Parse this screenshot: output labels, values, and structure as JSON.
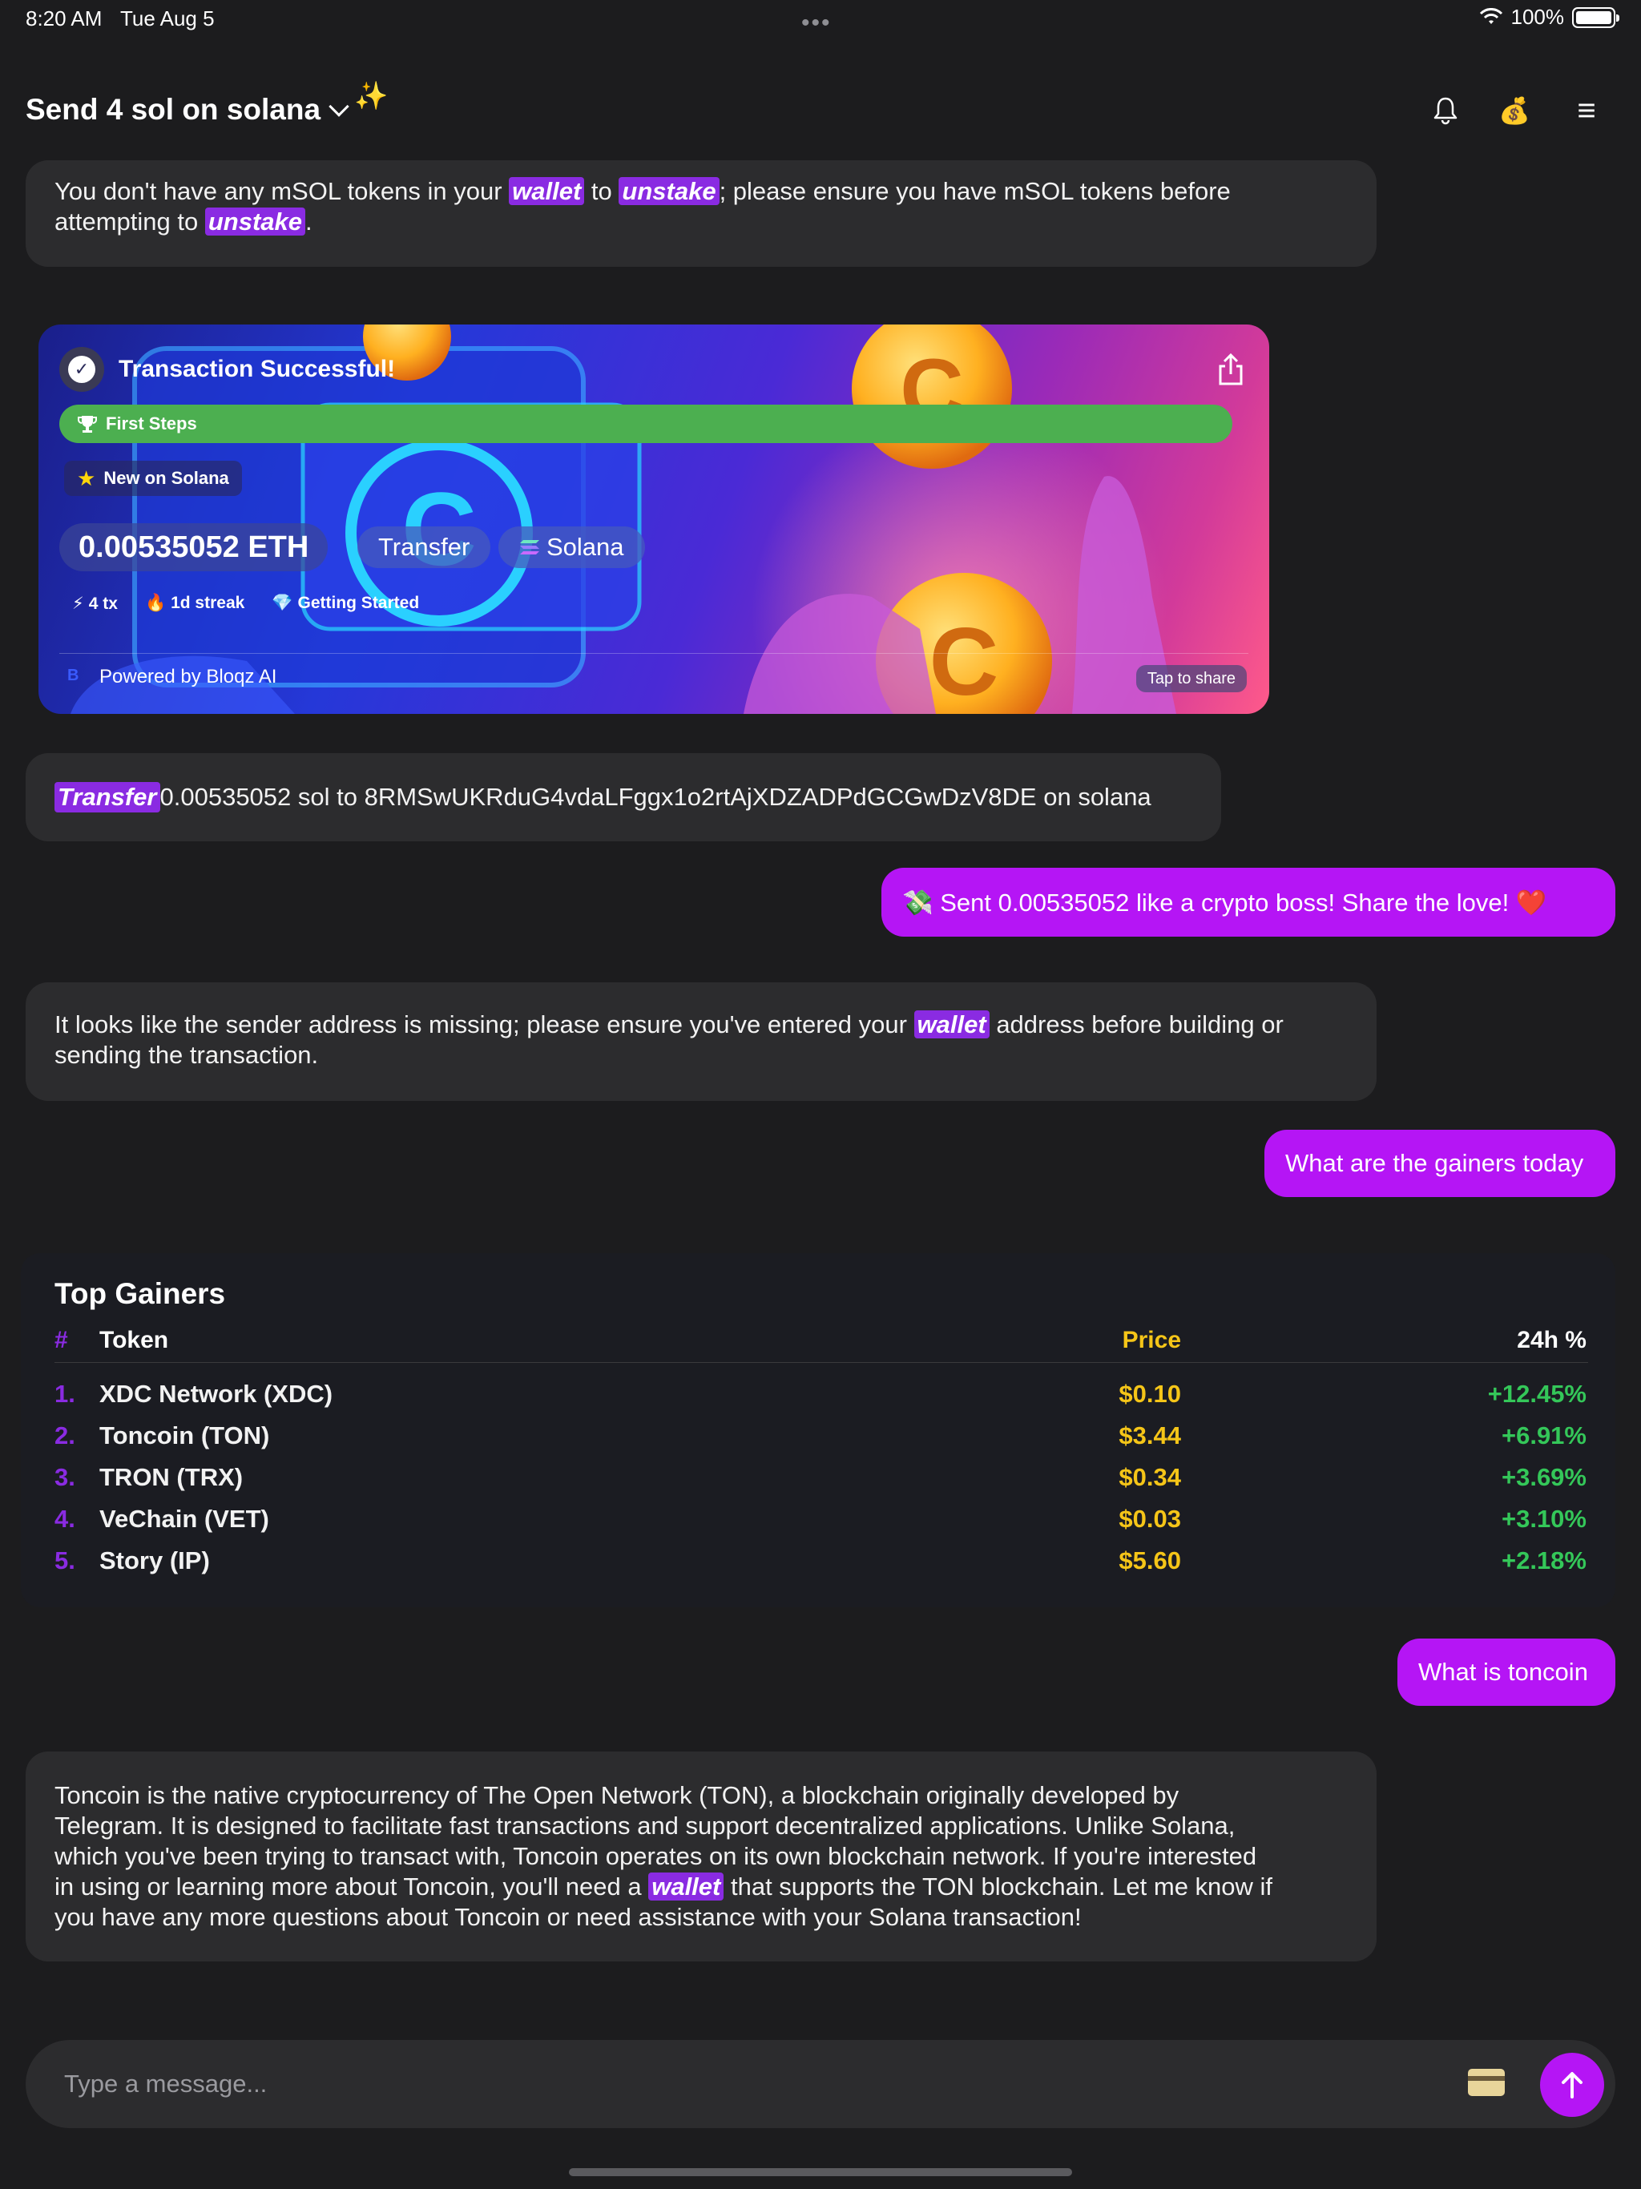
{
  "status": {
    "time": "8:20 AM",
    "date": "Tue Aug 5",
    "dots": "•••",
    "battery": "100%"
  },
  "header": {
    "title": "Send 4 sol on solana",
    "sparkle": "✨",
    "bell_icon": "bell-icon",
    "wallet_icon": "money-bag-icon",
    "wallet_glyph": "💰",
    "menu_icon": "hamburger-menu-icon",
    "menu_glyph": "≡"
  },
  "messages": {
    "m1": {
      "a": "You don't have any mSOL tokens in your ",
      "h1": "wallet",
      "b": " to ",
      "h2": "unstake",
      "c": "; please ensure you have mSOL tokens before",
      "d": "attempting to ",
      "h3": "unstake",
      "e": "."
    },
    "tx_card": {
      "check": "✓",
      "title": "Transaction Successful!",
      "progress_label": "First Steps",
      "progress_fraction": 1.0,
      "badge": "New on Solana",
      "amount": "0.00535052 ETH",
      "tag_transfer": "Transfer",
      "tag_chain": "Solana",
      "stat_tx": "4 tx",
      "stat_streak": "1d streak",
      "stat_started": "Getting Started",
      "logo": "B",
      "powered_by": "Powered by Bloqz AI",
      "tap_share": "Tap to share"
    },
    "m2": {
      "h1": "Transfer",
      "a": " 0.00535052 sol to 8RMSwUKRduG4vdaLFggx1o2rtAjXDZADPdGCGwDzV8DE on solana"
    },
    "u1": "💸 Sent 0.00535052  like a crypto boss! Share the love! ❤️",
    "m3": {
      "a": "It looks like the sender address is missing; please ensure you've entered your ",
      "h1": "wallet",
      "b": " address before building or",
      "c": "sending the transaction."
    },
    "u2": "What are the gainers today",
    "gainers": {
      "title": "Top Gainers",
      "headers": {
        "num": "#",
        "token": "Token",
        "price": "Price",
        "change": "24h %"
      },
      "rows": [
        {
          "num": "1.",
          "token": "XDC Network (XDC)",
          "price": "$0.10",
          "change": "+12.45%"
        },
        {
          "num": "2.",
          "token": "Toncoin (TON)",
          "price": "$3.44",
          "change": "+6.91%"
        },
        {
          "num": "3.",
          "token": "TRON (TRX)",
          "price": "$0.34",
          "change": "+3.69%"
        },
        {
          "num": "4.",
          "token": "VeChain (VET)",
          "price": "$0.03",
          "change": "+3.10%"
        },
        {
          "num": "5.",
          "token": "Story (IP)",
          "price": "$5.60",
          "change": "+2.18%"
        }
      ]
    },
    "u3": "What is toncoin",
    "m4": {
      "l1": "Toncoin is the native cryptocurrency of The Open Network (TON), a blockchain originally developed by",
      "l2": "Telegram. It is designed to facilitate fast transactions and support decentralized applications. Unlike Solana,",
      "l3": "which you've been trying to transact with, Toncoin operates on its own blockchain network. If you're interested",
      "l4a": "in using or learning more about Toncoin, you'll need a ",
      "h1": "wallet",
      "l4b": " that supports the TON blockchain. Let me know if",
      "l5": "you have any more questions about Toncoin or need assistance with your Solana transaction!"
    }
  },
  "composer": {
    "placeholder": "Type a message...",
    "card_icon": "credit-card-icon",
    "send_icon": "arrow-up-icon"
  },
  "colors": {
    "background": "#1c1c1e",
    "bubble_ai": "#2c2c2e",
    "bubble_user": "#b515f5",
    "highlight": "#8a2be2",
    "price": "#f5c518",
    "gain": "#34c759",
    "progress": "#4caf50"
  }
}
